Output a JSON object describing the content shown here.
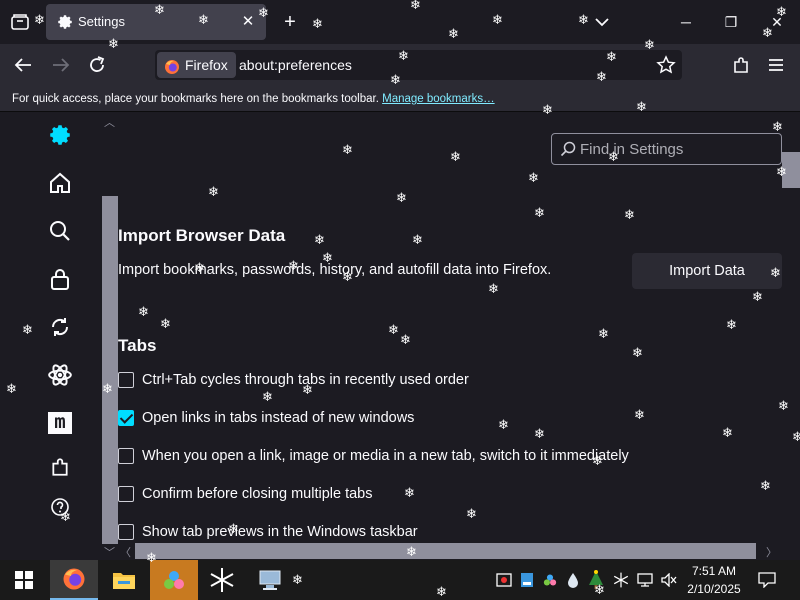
{
  "tabbar": {
    "tab_title": "Settings",
    "close_glyph": "✕",
    "new_tab_glyph": "+",
    "list_all_glyph": "⌄"
  },
  "window": {
    "minimize": "─",
    "maximize": "❐",
    "close": "✕"
  },
  "navbar": {
    "identity_label": "Firefox",
    "url": "about:preferences"
  },
  "bookmarks_bar": {
    "message": "For quick access, place your bookmarks here on the bookmarks toolbar. ",
    "link": "Manage bookmarks…"
  },
  "sidebar": {
    "items": [
      {
        "icon": "gear-icon",
        "active": true
      },
      {
        "icon": "home-icon"
      },
      {
        "icon": "search-icon"
      },
      {
        "icon": "lock-icon"
      },
      {
        "icon": "sync-icon"
      },
      {
        "icon": "atom-icon"
      },
      {
        "icon": "mozilla-icon",
        "glyph": "m"
      },
      {
        "icon": "extensions-icon"
      },
      {
        "icon": "help-icon"
      }
    ]
  },
  "search": {
    "placeholder": "Find in Settings"
  },
  "import": {
    "heading": "Import Browser Data",
    "description": "Import bookmarks, passwords, history, and autofill data into Firefox.",
    "button": "Import Data"
  },
  "tabs": {
    "heading": "Tabs",
    "options": [
      {
        "label": "Ctrl+Tab cycles through tabs in recently used order",
        "checked": false
      },
      {
        "label": "Open links in tabs instead of new windows",
        "checked": true
      },
      {
        "label": "When you open a link, image or media in a new tab, switch to it immediately",
        "checked": false
      },
      {
        "label": "Confirm before closing multiple tabs",
        "checked": false
      },
      {
        "label": "Show tab previews in the Windows taskbar",
        "checked": false
      }
    ]
  },
  "taskbar": {
    "apps": [
      "windows-start-icon",
      "firefox-icon",
      "file-explorer-icon",
      "app-icon",
      "snowflake-app-icon",
      "network-app-icon"
    ],
    "time": "7:51 AM",
    "date": "2/10/2025"
  },
  "colors": {
    "accent": "#00ddff",
    "link": "#80ebff",
    "background": "#1c1b22",
    "toolbar": "#2b2a33"
  }
}
